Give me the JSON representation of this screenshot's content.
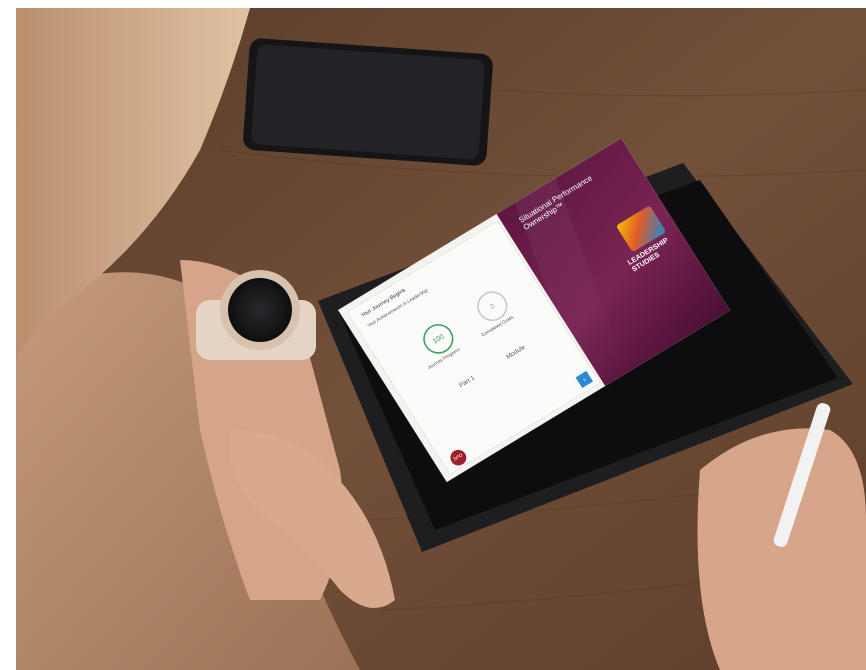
{
  "photo": {
    "description": "",
    "colors": {
      "table": "#6e4a33",
      "table_dark": "#4e3323",
      "sweater": "#b88d6e",
      "hair": "#c9a07d",
      "skin": "#d8a789",
      "tablet_frame": "#1e1d1f",
      "phone": "#1a1a1c",
      "watch_band": "#e7d6c6",
      "pencil": "#f2f2f2"
    }
  },
  "tablet_screen": {
    "brand": {
      "color": "#6b1b4a",
      "course_title": "Situational Performance Ownership™",
      "logo_text": "LEADERSHIP STUDIES",
      "logo_icon": "rainbow-logo-icon"
    },
    "panel": {
      "heading": "Your Journey Begins",
      "subheading": "Your Achievements in Leadership",
      "stats": [
        {
          "label": "Journey Progress",
          "value": "100",
          "icon": "progress-ring-icon"
        },
        {
          "label": "Completed Goals",
          "value": "0",
          "icon": "progress-ring-icon"
        }
      ],
      "part_label": "Part 1",
      "module_label": "Module",
      "badge": "SPO",
      "next_icon": "chevron-right-icon",
      "status_color": "#3aa35a"
    }
  }
}
